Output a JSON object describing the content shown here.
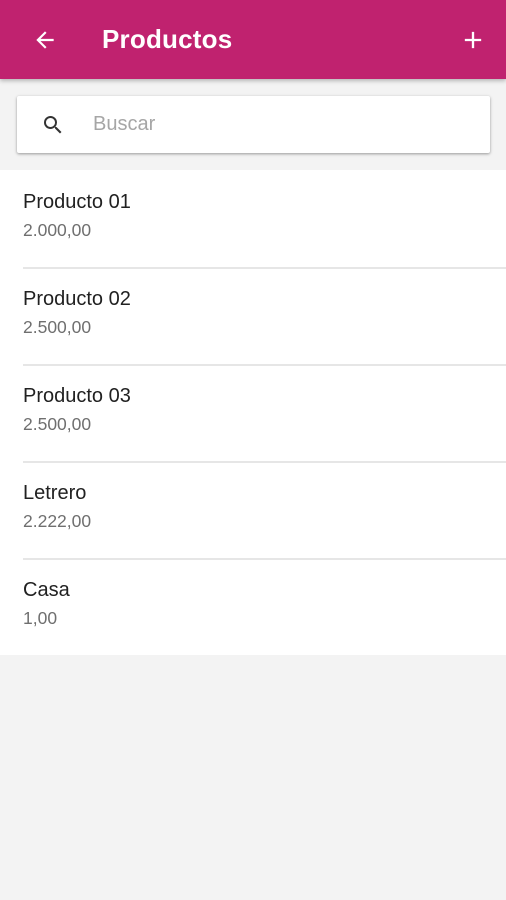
{
  "colors": {
    "appbar": "#c0226f",
    "background": "#f3f3f3",
    "card": "#ffffff"
  },
  "appbar": {
    "title": "Productos",
    "back_icon": "arrow-back-icon",
    "add_icon": "plus-icon"
  },
  "search": {
    "icon": "search-icon",
    "placeholder": "Buscar",
    "value": ""
  },
  "products": [
    {
      "name": "Producto 01",
      "price": "2.000,00"
    },
    {
      "name": "Producto 02",
      "price": "2.500,00"
    },
    {
      "name": "Producto 03",
      "price": "2.500,00"
    },
    {
      "name": "Letrero",
      "price": "2.222,00"
    },
    {
      "name": "Casa",
      "price": "1,00"
    }
  ]
}
